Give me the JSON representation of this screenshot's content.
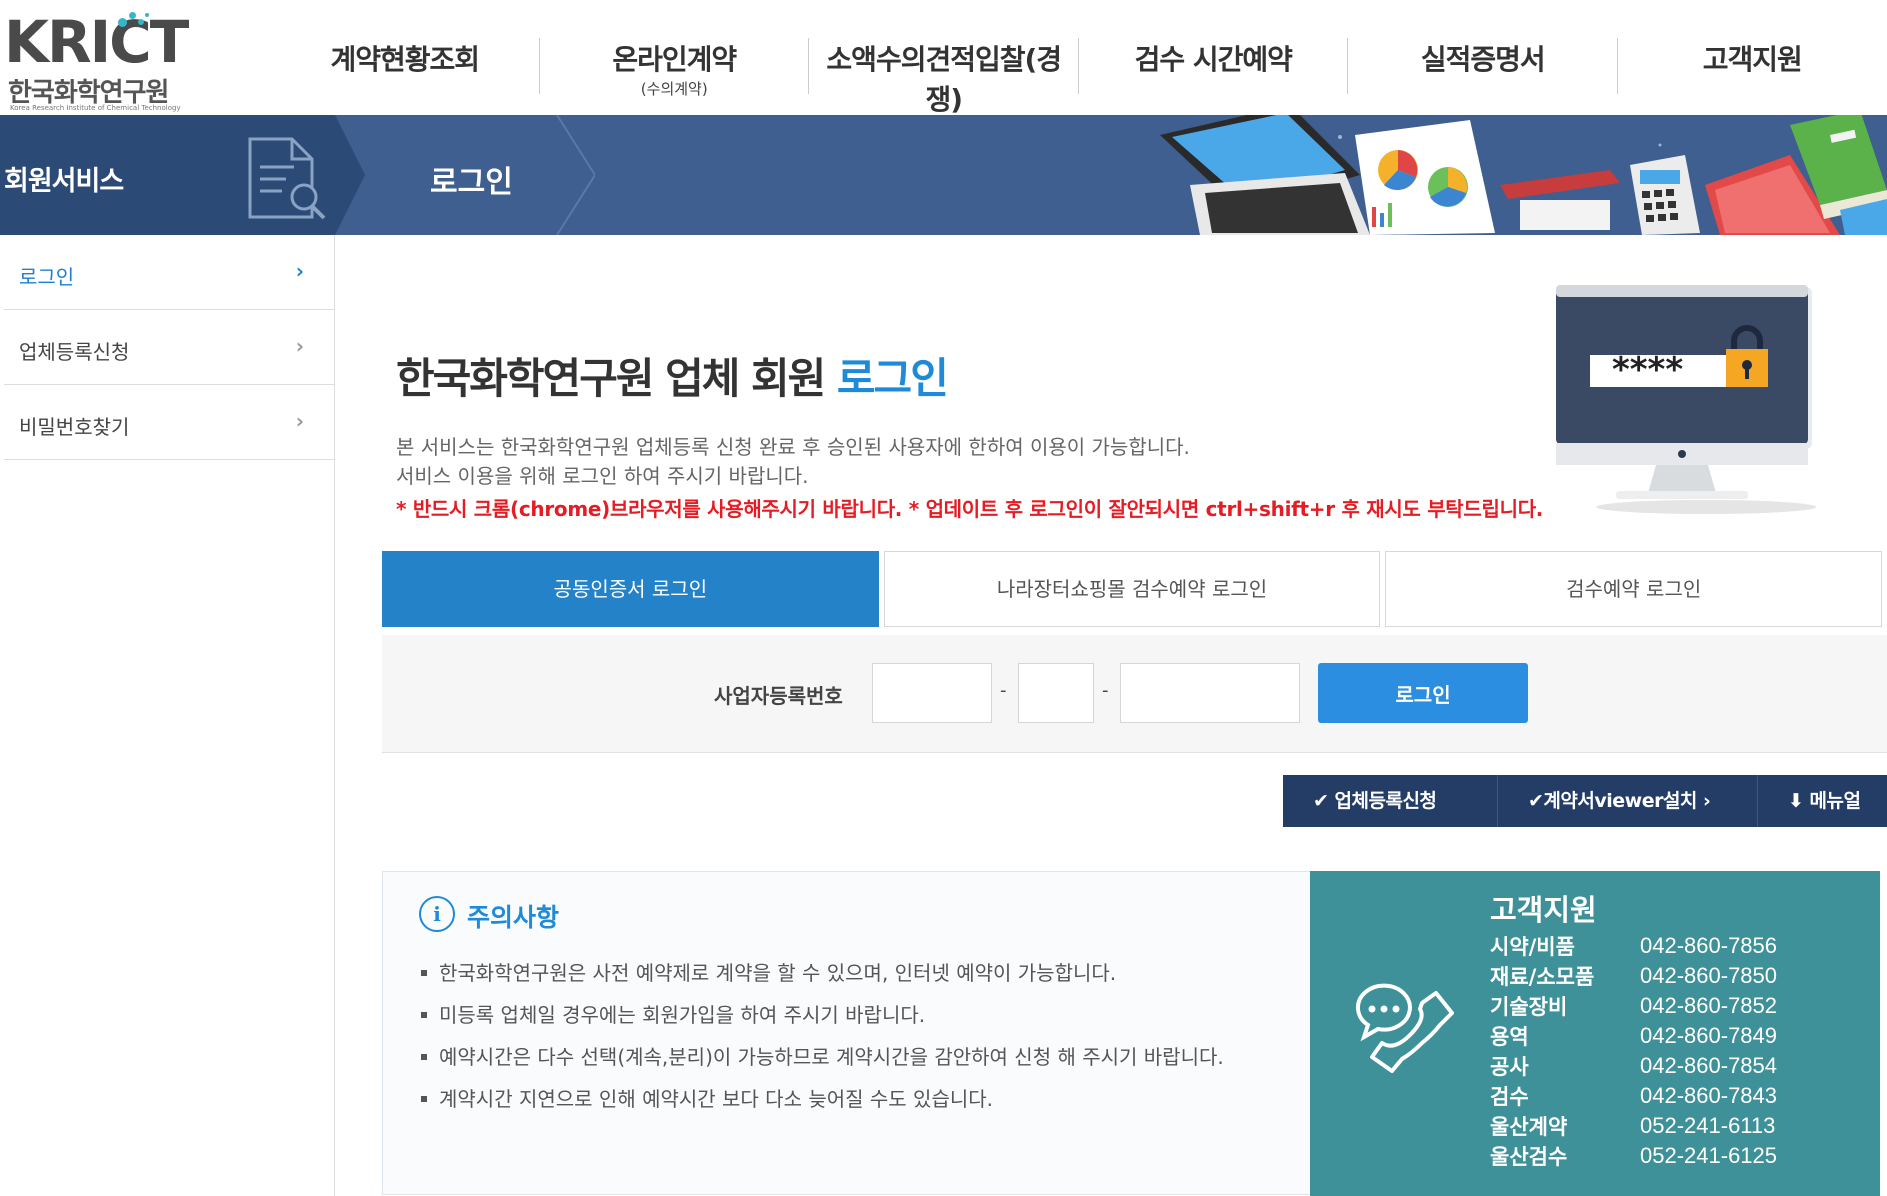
{
  "header": {
    "logo": {
      "brand": "KRICT",
      "kor": "한국화학연구원",
      "eng": "Korea Research Institute of Chemical Technology"
    },
    "nav": [
      {
        "label": "계약현황조회",
        "sub": ""
      },
      {
        "label": "온라인계약",
        "sub": "(수의계약)"
      },
      {
        "label": "소액수의견적입찰(경쟁)",
        "sub": ""
      },
      {
        "label": "검수 시간예약",
        "sub": ""
      },
      {
        "label": "실적증명서",
        "sub": ""
      },
      {
        "label": "고객지원",
        "sub": ""
      }
    ]
  },
  "banner": {
    "section": "회원서비스",
    "current": "로그인"
  },
  "sidebar": {
    "items": [
      {
        "label": "로그인",
        "active": true
      },
      {
        "label": "업체등록신청",
        "active": false
      },
      {
        "label": "비밀번호찾기",
        "active": false
      }
    ],
    "arrow": "›"
  },
  "main": {
    "title_prefix": "한국화학연구원 업체 회원 ",
    "title_highlight": "로그인",
    "desc1": "본 서비스는 한국화학연구원 업체등록 신청 완료 후 승인된 사용자에 한하여 이용이 가능합니다.",
    "desc2": "서비스 이용을 위해 로그인 하여 주시기 바랍니다.",
    "warning": "* 반드시 크롬(chrome)브라우저를 사용해주시기 바랍니다. * 업데이트 후 로그인이 잘안되시면 ctrl+shift+r 후 재시도 부탁드립니다.",
    "monitor_mask": "****",
    "tabs": [
      {
        "label": "공동인증서 로그인",
        "active": true
      },
      {
        "label": "나라장터쇼핑몰 검수예약 로그인",
        "active": false
      },
      {
        "label": "검수예약 로그인",
        "active": false
      }
    ],
    "login": {
      "label": "사업자등록번호",
      "part1": "",
      "part2": "",
      "part3": "",
      "dash": "-",
      "button": "로그인"
    },
    "quick": [
      {
        "label": "✔ 업체등록신청"
      },
      {
        "label": "✔계약서viewer설치 ›"
      },
      {
        "label": "⬇ 메뉴얼"
      }
    ],
    "notice": {
      "icon": "i",
      "title": "주의사항",
      "items": [
        "한국화학연구원은 사전 예약제로 계약을 할 수 있으며, 인터넷 예약이 가능합니다.",
        "미등록 업체일 경우에는 회원가입을 하여 주시기 바랍니다.",
        "예약시간은 다수 선택(계속,분리)이 가능하므로 계약시간을 감안하여 신청 해 주시기 바랍니다.",
        "계약시간 지연으로 인해 예약시간 보다 다소 늦어질 수도 있습니다."
      ]
    },
    "support": {
      "title": "고객지원",
      "contacts": [
        {
          "k": "시약/비품",
          "v": "042-860-7856"
        },
        {
          "k": "재료/소모품",
          "v": "042-860-7850"
        },
        {
          "k": "기술장비",
          "v": "042-860-7852"
        },
        {
          "k": "용역",
          "v": "042-860-7849"
        },
        {
          "k": "공사",
          "v": "042-860-7854"
        },
        {
          "k": "검수",
          "v": "042-860-7843"
        },
        {
          "k": "울산계약",
          "v": "052-241-6113"
        },
        {
          "k": "울산검수",
          "v": "052-241-6125"
        }
      ]
    }
  },
  "colors": {
    "accent": "#2382c8",
    "banner": "#3e5f8f",
    "banner_dark": "#2b4a76",
    "warning": "#e51c23",
    "support_bg": "#3e9099",
    "quick_bg": "#243d66"
  }
}
